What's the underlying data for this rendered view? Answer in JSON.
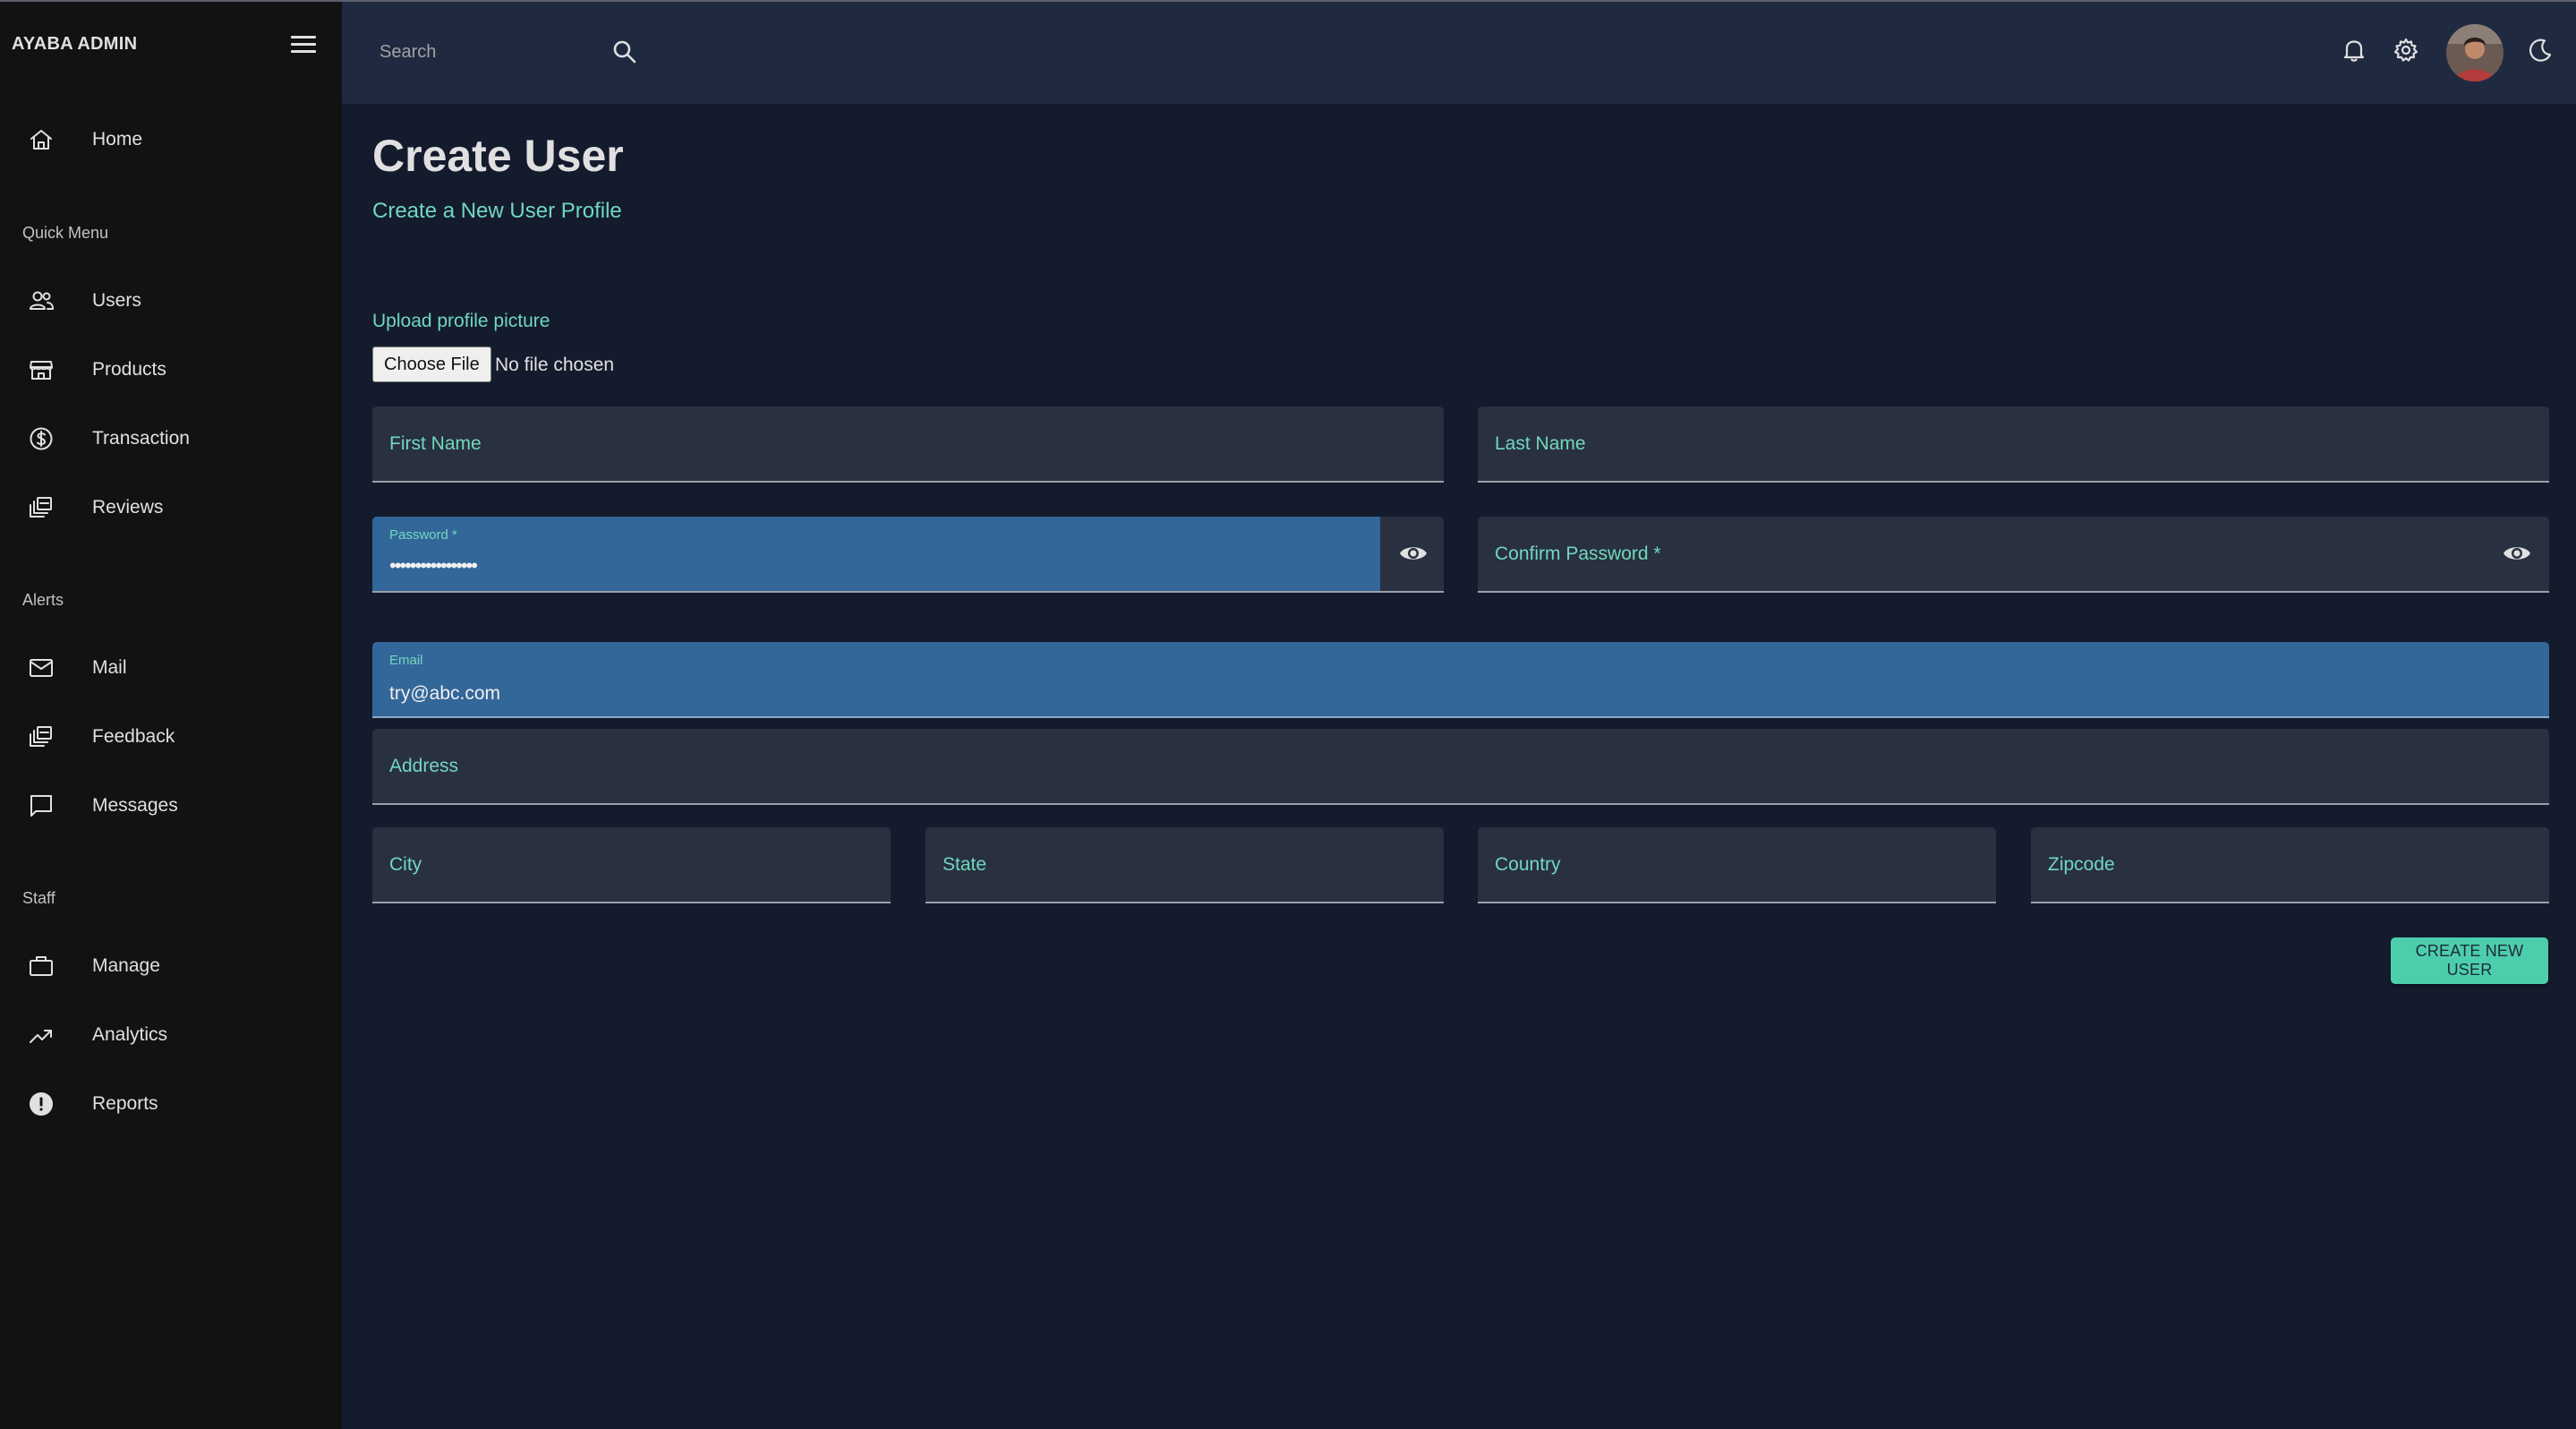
{
  "sidebar": {
    "brand": "AYABA ADMIN",
    "home": {
      "label": "Home",
      "icon": "home-icon"
    },
    "sections": {
      "quick_menu": "Quick Menu",
      "alerts": "Alerts",
      "staff": "Staff"
    },
    "quick_menu_items": [
      {
        "label": "Users",
        "icon": "people-icon"
      },
      {
        "label": "Products",
        "icon": "storefront-icon"
      },
      {
        "label": "Transaction",
        "icon": "dollar-circle-icon"
      },
      {
        "label": "Reviews",
        "icon": "stacked-cards-icon"
      }
    ],
    "alerts_items": [
      {
        "label": "Mail",
        "icon": "mail-icon"
      },
      {
        "label": "Feedback",
        "icon": "stacked-cards-icon"
      },
      {
        "label": "Messages",
        "icon": "chat-bubble-icon"
      }
    ],
    "staff_items": [
      {
        "label": "Manage",
        "icon": "briefcase-icon"
      },
      {
        "label": "Analytics",
        "icon": "trending-up-icon"
      },
      {
        "label": "Reports",
        "icon": "alert-circle-icon"
      }
    ]
  },
  "topbar": {
    "search_placeholder": "Search",
    "icons": [
      "search-icon",
      "bell-icon",
      "gear-icon",
      "avatar",
      "moon-icon"
    ]
  },
  "page": {
    "title": "Create User",
    "subtitle": "Create a New User Profile"
  },
  "form": {
    "upload_label": "Upload profile picture",
    "choose_file_label": "Choose File",
    "no_file_text": "No file chosen",
    "first_name_label": "First Name",
    "last_name_label": "Last Name",
    "password_label": "Password *",
    "password_value": "•••••••••••••••••",
    "confirm_password_label": "Confirm Password *",
    "email_label": "Email",
    "email_value": "try@abc.com",
    "address_label": "Address",
    "city_label": "City",
    "state_label": "State",
    "country_label": "Country",
    "zipcode_label": "Zipcode",
    "submit_label": "CREATE NEW USER"
  },
  "colors": {
    "accent": "#70d8bd",
    "button": "#4cceac",
    "sidebar_bg": "#121212",
    "topbar_bg": "#1f2a40",
    "body_bg": "#141b2d",
    "field_bg": "#293040",
    "active_field_bg": "#336699"
  }
}
